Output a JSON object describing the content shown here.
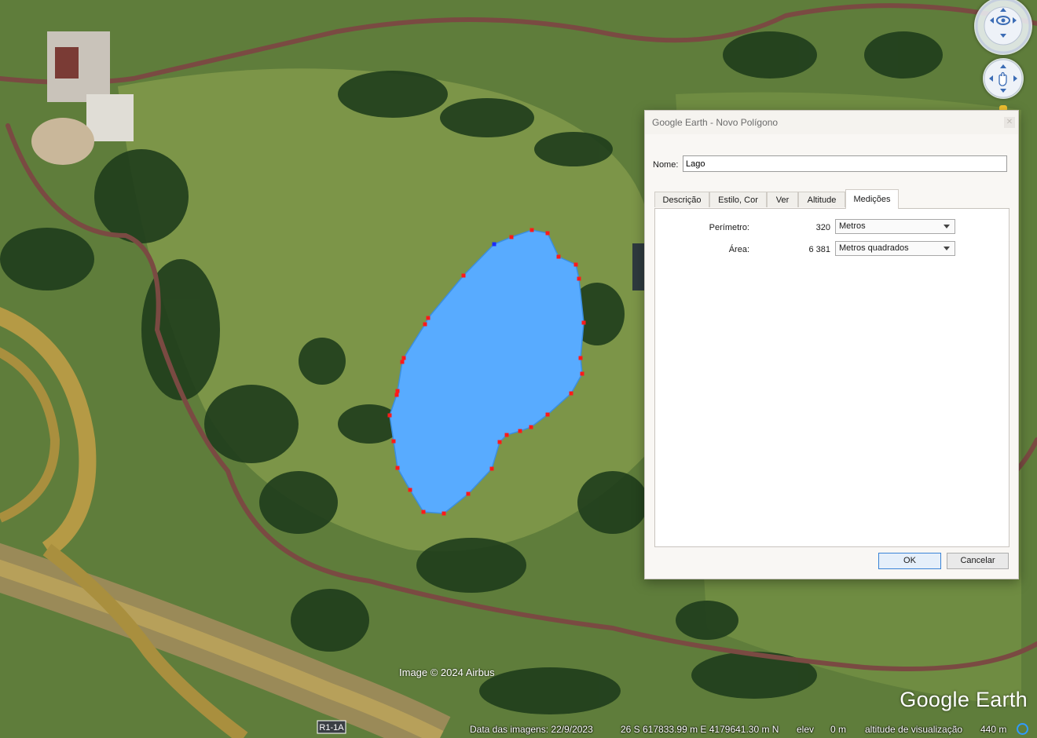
{
  "map": {
    "credit": "Image © 2024 Airbus",
    "logo": "Google Earth",
    "road_label": "R1-1A",
    "polygon_fill": "#58abff",
    "vertex_color": "#ff1a1a",
    "selected_vertex_color": "#1b2cff"
  },
  "status": {
    "imagery_date": "Data das imagens: 22/9/2023",
    "coordinates": "26 S 617833.99 m E 4179641.30 m N",
    "elev_label": "elev",
    "elev_value": "0 m",
    "eye_alt_label": "altitude de visualização",
    "eye_alt_value": "440 m"
  },
  "nav": {
    "look_icon": "look-around-icon",
    "move_icon": "pan-hand-icon"
  },
  "dialog": {
    "title": "Google Earth - Novo Polígono",
    "close_icon": "close-icon",
    "name_label": "Nome:",
    "name_value": "Lago",
    "tabs": [
      {
        "label": "Descrição"
      },
      {
        "label": "Estilo, Cor"
      },
      {
        "label": "Ver"
      },
      {
        "label": "Altitude"
      },
      {
        "label": "Medições",
        "active": true
      }
    ],
    "measurements": {
      "perimeter_label": "Perímetro:",
      "perimeter_value": "320",
      "perimeter_unit": "Metros",
      "area_label": "Área:",
      "area_value": "6 381",
      "area_unit": "Metros quadrados"
    },
    "ok_label": "OK",
    "cancel_label": "Cancelar"
  }
}
